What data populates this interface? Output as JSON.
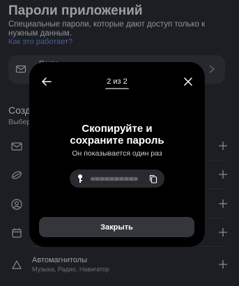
{
  "page": {
    "title": "Пароли приложений",
    "description": "Специальные пароли, которые дают доступ только к нужным данным.",
    "help_link": "Как это работает?"
  },
  "existing_password": {
    "name": "Почта",
    "icon": "mail-icon"
  },
  "create_section": {
    "title": "Создать",
    "subtitle": "Выберите"
  },
  "app_types": [
    {
      "icon": "mail-icon",
      "title": "",
      "subtitle": ""
    },
    {
      "icon": "disk-icon",
      "title": "",
      "subtitle": ""
    },
    {
      "icon": "contacts-icon",
      "title": "",
      "subtitle": ""
    },
    {
      "icon": "calendar-icon",
      "title": "",
      "subtitle": ""
    },
    {
      "icon": "car-icon",
      "title": "Автомагнитолы",
      "subtitle": "Музыка, Радио, Навигатор"
    }
  ],
  "modal": {
    "step": "2 из 2",
    "heading_line1": "Скопируйте и",
    "heading_line2": "сохраните пароль",
    "hint": "Он показывается один раз",
    "close_label": "Закрыть"
  },
  "colors": {
    "background": "#2a2d35",
    "card": "#383b44",
    "modal": "#000000",
    "link": "#6e8bd6",
    "button": "#34363b"
  }
}
